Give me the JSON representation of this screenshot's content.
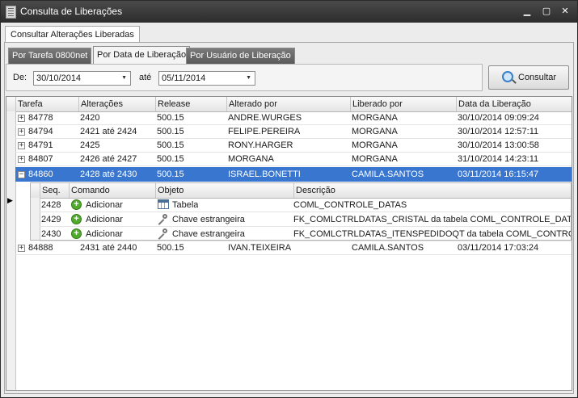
{
  "window": {
    "title": "Consulta de Liberações",
    "minimize": "▁",
    "maximize": "▢",
    "close": "✕"
  },
  "outer_tab": "Consultar Alterações Liberadas",
  "inner_tabs": [
    "Por Tarefa 0800net",
    "Por Data de Liberação",
    "Por Usuário de Liberação"
  ],
  "active_inner_tab": "Por Data de Liberação",
  "filter": {
    "from_label": "De:",
    "from_value": "30/10/2014",
    "to_label": "até",
    "to_value": "05/11/2014",
    "button": "Consultar"
  },
  "grid": {
    "columns": [
      "Tarefa",
      "Alterações",
      "Release",
      "Alterado por",
      "Liberado por",
      "Data da Liberação"
    ],
    "rows": [
      {
        "tarefa": "84778",
        "alteracoes": "2420",
        "release": "500.15",
        "alterado": "ANDRE.WURGES",
        "liberado": "MORGANA",
        "data": "30/10/2014 09:09:24",
        "expander": "+"
      },
      {
        "tarefa": "84794",
        "alteracoes": "2421 até 2424",
        "release": "500.15",
        "alterado": "FELIPE.PEREIRA",
        "liberado": "MORGANA",
        "data": "30/10/2014 12:57:11",
        "expander": "+"
      },
      {
        "tarefa": "84791",
        "alteracoes": "2425",
        "release": "500.15",
        "alterado": "RONY.HARGER",
        "liberado": "MORGANA",
        "data": "30/10/2014 13:00:58",
        "expander": "+"
      },
      {
        "tarefa": "84807",
        "alteracoes": "2426 até 2427",
        "release": "500.15",
        "alterado": "MORGANA",
        "liberado": "MORGANA",
        "data": "31/10/2014 14:23:11",
        "expander": "+"
      },
      {
        "tarefa": "84860",
        "alteracoes": "2428 até 2430",
        "release": "500.15",
        "alterado": "ISRAEL.BONETTI",
        "liberado": "CAMILA.SANTOS",
        "data": "03/11/2014 16:15:47",
        "expander": "−"
      },
      {
        "tarefa": "84888",
        "alteracoes": "2431 até 2440",
        "release": "500.15",
        "alterado": "IVAN.TEIXEIRA",
        "liberado": "CAMILA.SANTOS",
        "data": "03/11/2014 17:03:24",
        "expander": "+"
      }
    ],
    "selected_row_indicator": "▶"
  },
  "detail": {
    "columns": [
      "Seq.",
      "Comando",
      "Objeto",
      "Descrição"
    ],
    "rows": [
      {
        "seq": "2428",
        "comando": "Adicionar",
        "objeto": "Tabela",
        "objeto_icon": "table-icon",
        "descricao": "COML_CONTROLE_DATAS"
      },
      {
        "seq": "2429",
        "comando": "Adicionar",
        "objeto": "Chave estrangeira",
        "objeto_icon": "key-icon",
        "descricao": "FK_COMLCTRLDATAS_CRISTAL da tabela COML_CONTROLE_DATAS"
      },
      {
        "seq": "2430",
        "comando": "Adicionar",
        "objeto": "Chave estrangeira",
        "objeto_icon": "key-icon",
        "descricao": "FK_COMLCTRLDATAS_ITENSPEDIDOQT da tabela COML_CONTROLE_DATAS"
      }
    ],
    "add_icon_glyph": "+"
  },
  "colors": {
    "selection": "#3876d0",
    "titlebar": "#2c2c2c",
    "add_icon": "#4fab2a"
  }
}
